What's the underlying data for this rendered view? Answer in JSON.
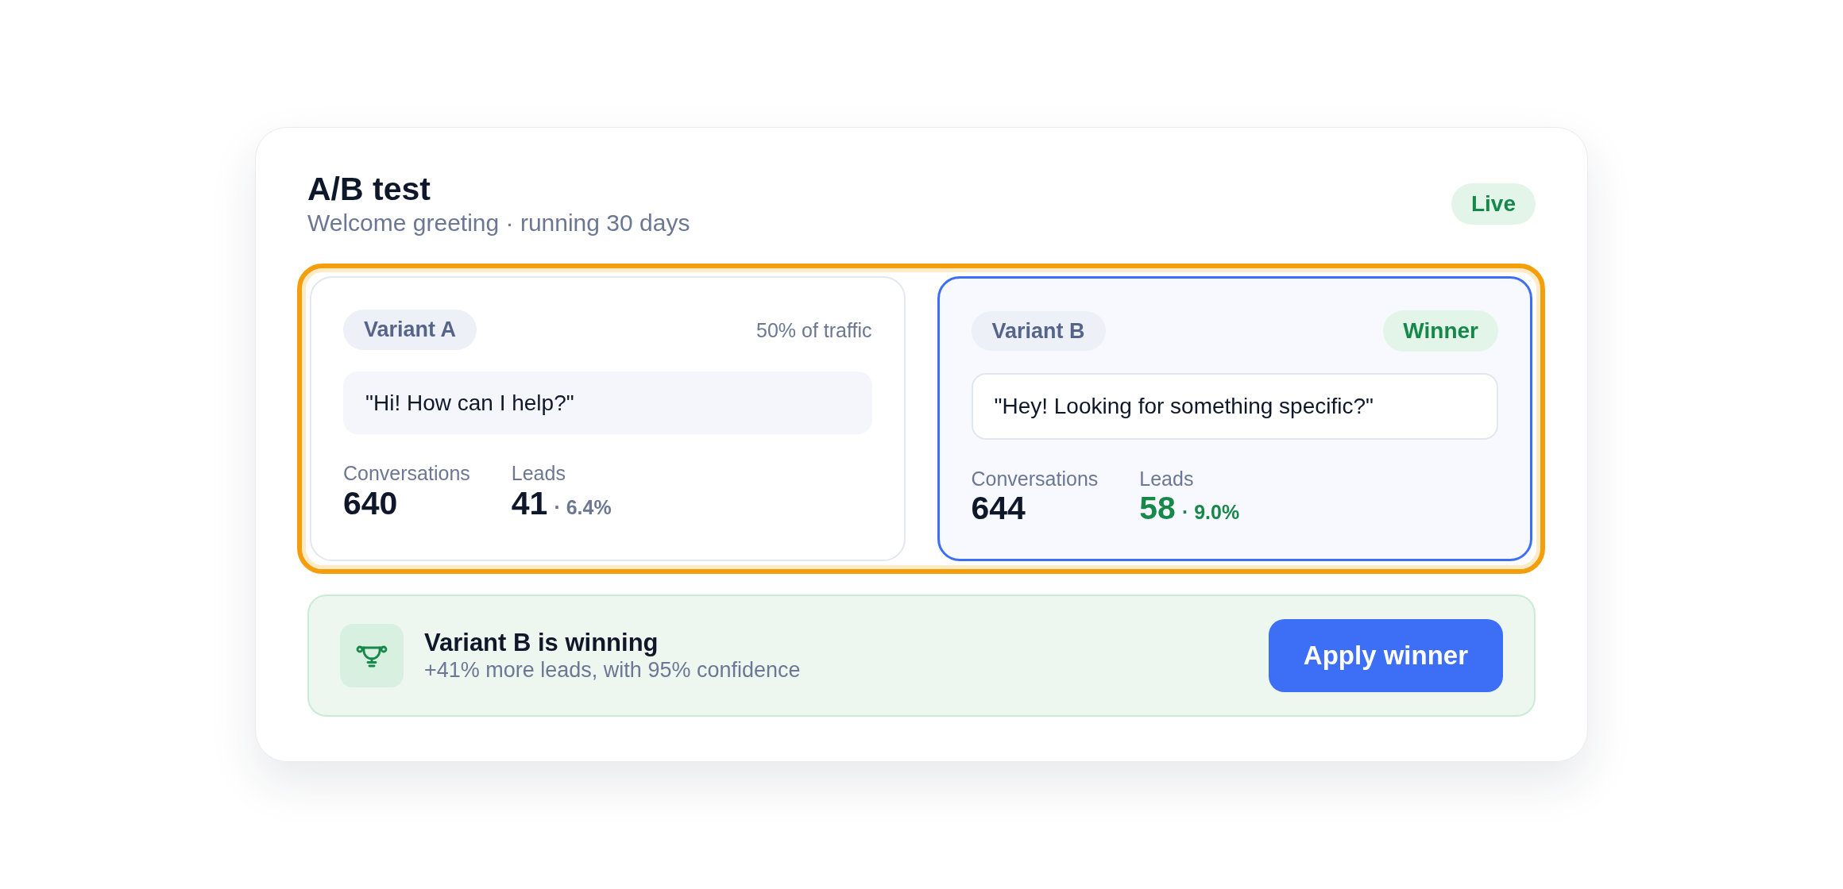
{
  "header": {
    "title": "A/B test",
    "subtitle": "Welcome greeting · running 30 days",
    "status": "Live"
  },
  "variants": [
    {
      "name": "Variant A",
      "traffic": "50% of traffic",
      "selected": false,
      "message": "\"Hi! How can I help?\"",
      "stats": [
        {
          "label": "Conversations",
          "value": "640",
          "highlighted": false
        },
        {
          "label": "Leads",
          "value": "41",
          "rate": "· 6.4%",
          "highlighted": false
        }
      ]
    },
    {
      "name": "Variant B",
      "badge": "Winner",
      "selected": true,
      "message": "\"Hey! Looking for something specific?\"",
      "stats": [
        {
          "label": "Conversations",
          "value": "644",
          "highlighted": false
        },
        {
          "label": "Leads",
          "value": "58",
          "rate": "· 9.0%",
          "highlighted": true
        }
      ]
    }
  ],
  "result": {
    "title": "Variant B is winning",
    "detail": "+41% more leads, with 95% confidence",
    "button": "Apply winner"
  }
}
